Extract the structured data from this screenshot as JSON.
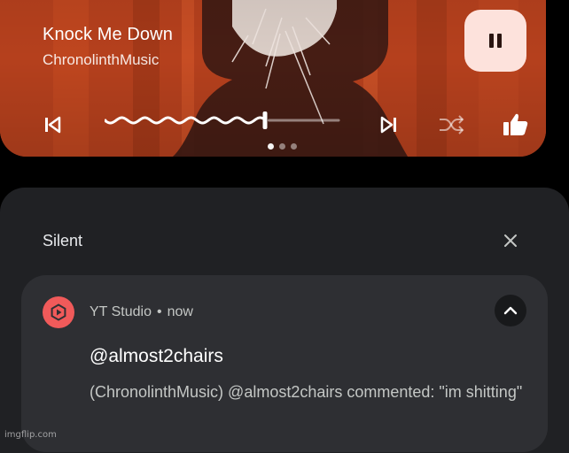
{
  "media": {
    "title": "Knock Me Down",
    "artist": "ChronolinthMusic",
    "progress_fraction": 0.68,
    "page_count": 3,
    "active_page": 0,
    "colors": {
      "card": "#b9401c",
      "pause_bg": "#fde2dc",
      "icon": "#ffffff"
    },
    "icons": {
      "pause": "pause-icon",
      "previous": "skip-previous-icon",
      "next": "skip-next-icon",
      "shuffle": "shuffle-icon",
      "like": "thumbs-up-icon"
    }
  },
  "shade": {
    "section_title": "Silent",
    "dismiss_icon": "close-icon"
  },
  "notification": {
    "app_name": "YT Studio",
    "separator": "•",
    "time": "now",
    "title": "@almost2chairs",
    "body": "(ChronolinthMusic) @almost2chairs commented: \"im shitting\"",
    "app_icon": "yt-studio-icon",
    "expand_icon": "chevron-up-icon",
    "colors": {
      "card": "#2e2f33",
      "app_icon_bg": "#f05a5a"
    }
  },
  "watermark": "imgflip.com"
}
